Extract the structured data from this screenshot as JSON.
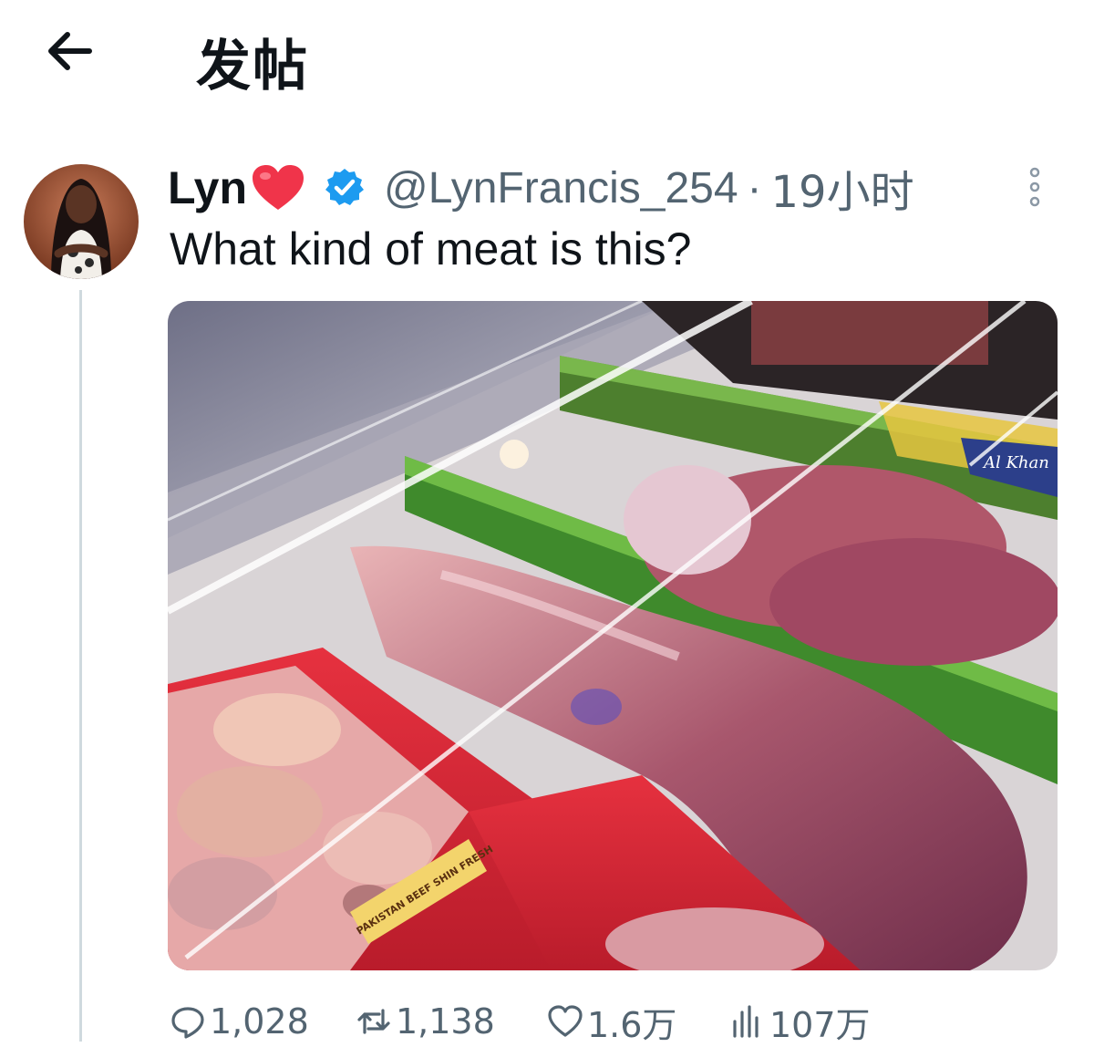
{
  "header": {
    "title": "发帖"
  },
  "tweet": {
    "display_name": "Lyn",
    "handle": "@LynFrancis_254",
    "separator": "·",
    "time": "19小时",
    "text": "What kind of meat is this?",
    "media_labels": {
      "brand": "Al Khan",
      "sign": "PAKISTAN BEEF SHIN FRESH"
    }
  },
  "actions": {
    "replies": "1,028",
    "retweets": "1,138",
    "likes": "1.6万",
    "views": "107万"
  },
  "colors": {
    "verified": "#1d9bf0",
    "heart": "#f0344a",
    "muted": "#536471"
  }
}
